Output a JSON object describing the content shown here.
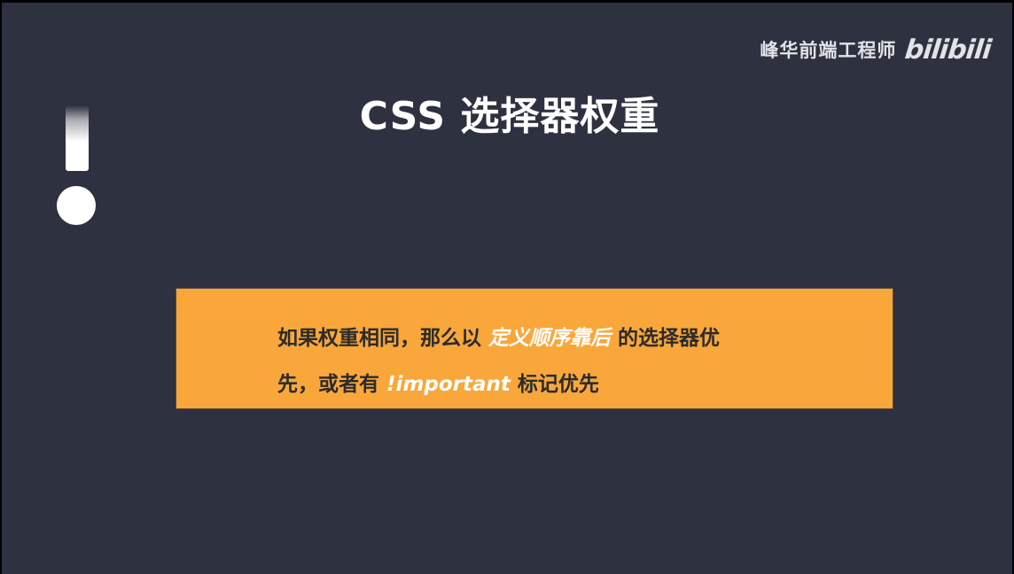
{
  "watermark": {
    "channel": "峰华前端工程师",
    "brand": "bilibili"
  },
  "slide": {
    "title": "CSS 选择器权重",
    "callout": {
      "line1_prefix": "如果权重相同，那么以 ",
      "line1_emphasis": "定义顺序靠后",
      "line1_suffix": " 的选择器优",
      "line2_prefix": "先，或者有 ",
      "line2_emphasis": "!important",
      "line2_suffix": " 标记优先"
    }
  },
  "colors": {
    "background": "#2e3140",
    "callout_bg": "#f9a73b",
    "emphasis": "#ffffff",
    "text_dark": "#2b2b2b"
  },
  "icons": [
    "exclamation-mark-icon",
    "bilibili-logo"
  ]
}
